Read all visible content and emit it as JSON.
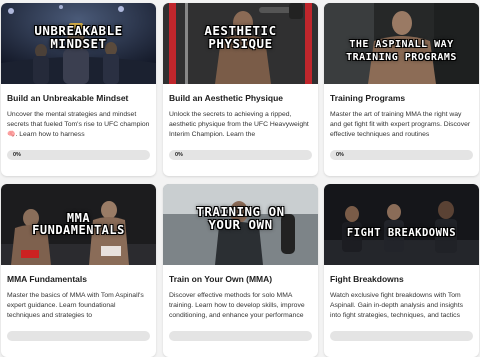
{
  "cards": [
    {
      "overlay_lines": [
        "UNBREAKABLE",
        "MINDSET"
      ],
      "title": "Build an Unbreakable Mindset",
      "description": "Uncover the mental strategies and mindset secrets that fueled Tom's rise to UFC champion 🧠. Learn how to harness",
      "progress": "0%",
      "progress_value": 0
    },
    {
      "overlay_lines": [
        "AESTHETIC",
        "PHYSIQUE"
      ],
      "title": "Build an Aesthetic Physique",
      "description": "Unlock the secrets to achieving a ripped, aesthetic physique from the UFC Heavyweight Interim Champion. Learn the",
      "progress": "0%",
      "progress_value": 0
    },
    {
      "overlay_lines": [
        "THE ASPINALL WAY",
        "TRAINING PROGRAMS"
      ],
      "title": "Training Programs",
      "description": "Master the art of training MMA the right way and get fight fit with expert programs. Discover effective techniques and routines",
      "progress": "0%",
      "progress_value": 0
    },
    {
      "overlay_lines": [
        "MMA",
        "FUNDAMENTALS"
      ],
      "title": "MMA Fundamentals",
      "description": "Master the basics of MMA with Tom Aspinall's expert guidance. Learn foundational techniques and strategies to",
      "progress": "",
      "progress_value": 0
    },
    {
      "overlay_lines": [
        "TRAINING ON",
        "YOUR OWN"
      ],
      "title": "Train on Your Own (MMA)",
      "description": "Discover effective methods for solo MMA training. Learn how to develop skills, improve conditioning, and enhance your performance",
      "progress": "",
      "progress_value": 0
    },
    {
      "overlay_lines": [
        "FIGHT BREAKDOWNS"
      ],
      "title": "Fight Breakdowns",
      "description": "Watch exclusive fight breakdowns with Tom Aspinall. Gain in-depth analysis and insights into fight strategies, techniques, and tactics",
      "progress": "",
      "progress_value": 0
    }
  ]
}
